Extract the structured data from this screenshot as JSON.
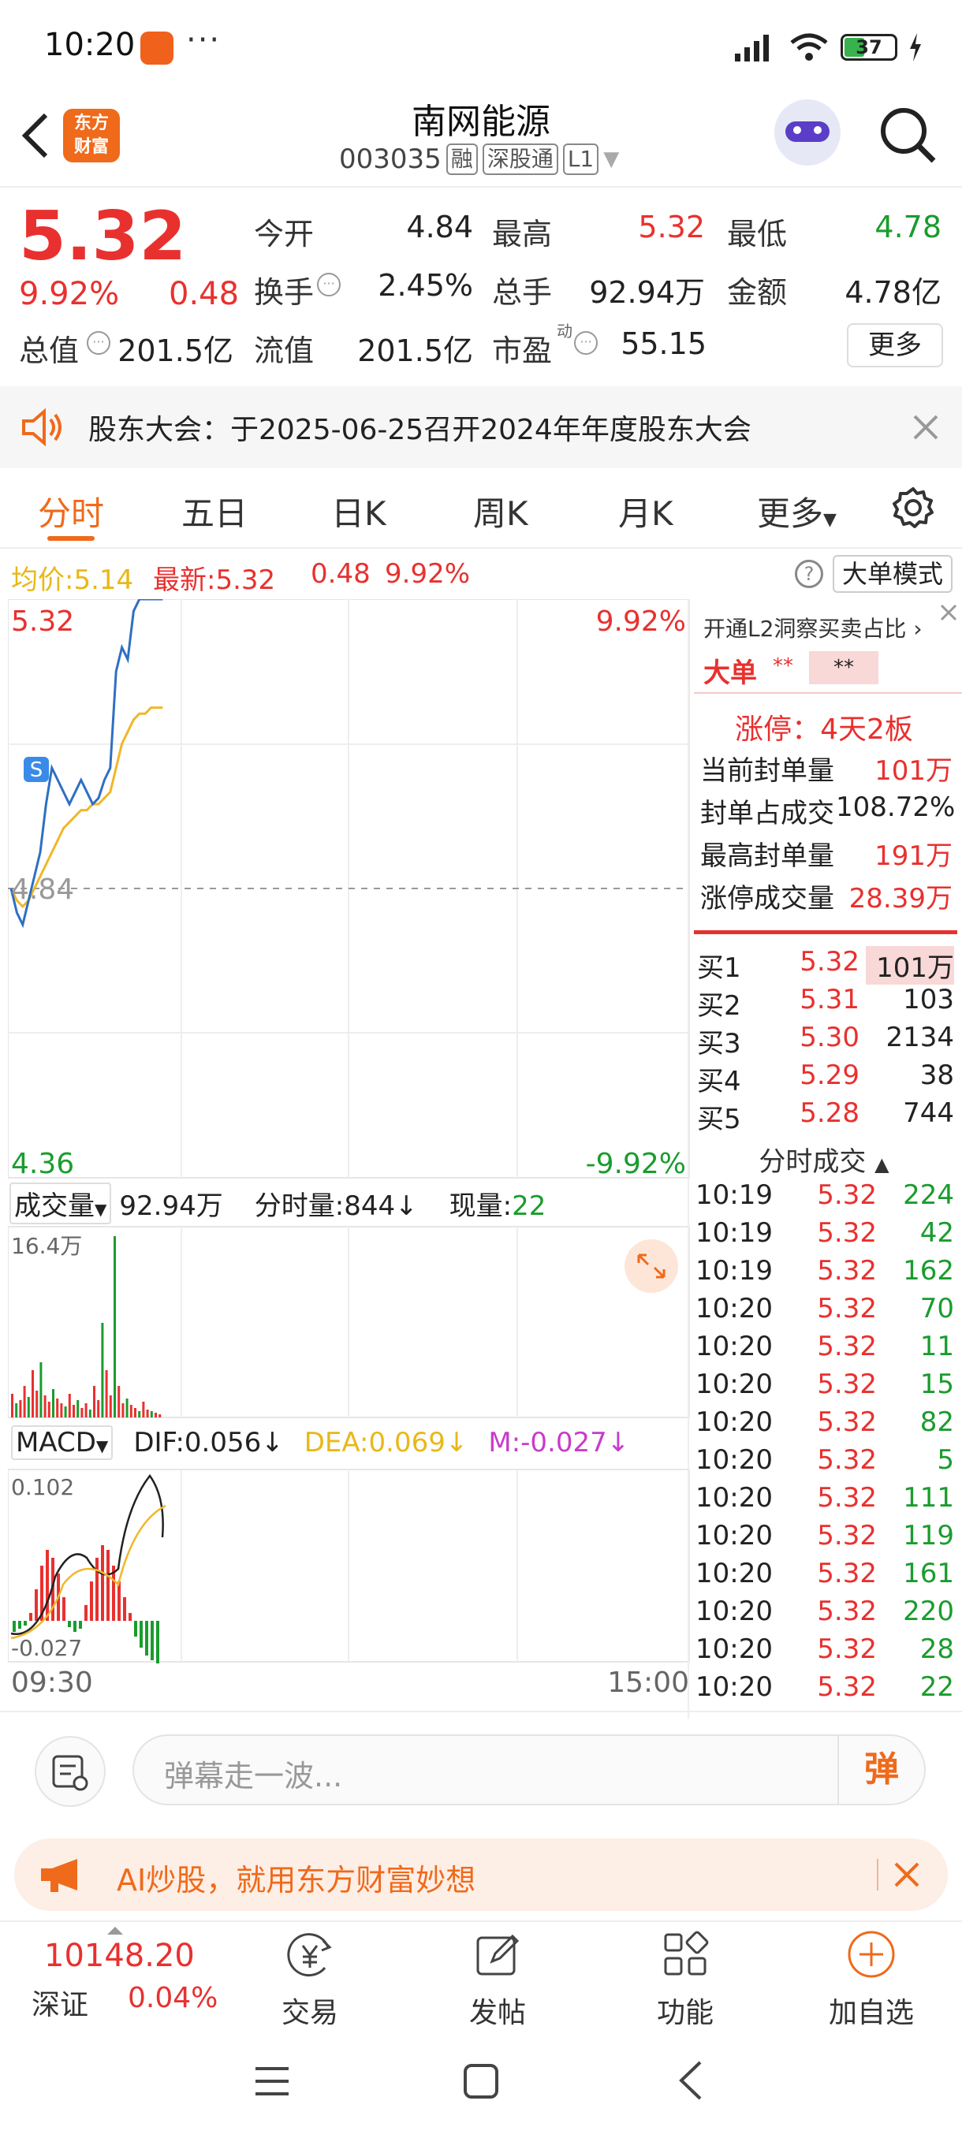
{
  "status_bar": {
    "time": "10:20",
    "battery": "37"
  },
  "header": {
    "title": "南网能源",
    "code": "003035",
    "tags": [
      "融",
      "深股通",
      "L1"
    ],
    "logo_lines": [
      "东方",
      "财富"
    ]
  },
  "quote": {
    "price": "5.32",
    "pct": "9.92%",
    "change": "0.48",
    "rows": [
      [
        {
          "l": "今开",
          "v": "4.84",
          "c": "black"
        },
        {
          "l": "最高",
          "v": "5.32",
          "c": "red"
        },
        {
          "l": "最低",
          "v": "4.78",
          "c": "green"
        }
      ],
      [
        {
          "l": "换手",
          "v": "2.45%",
          "c": "black"
        },
        {
          "l": "总手",
          "v": "92.94万",
          "c": "black"
        },
        {
          "l": "金额",
          "v": "4.78亿",
          "c": "black"
        }
      ],
      [
        {
          "l": "总值",
          "v": "201.5亿",
          "c": "black"
        },
        {
          "l": "流值",
          "v": "201.5亿",
          "c": "black"
        },
        {
          "l": "市盈",
          "v": "55.15",
          "c": "black",
          "sup": "动"
        }
      ]
    ],
    "more_label": "更多"
  },
  "notice": {
    "text": "股东大会：于2025-06-25召开2024年年度股东大会"
  },
  "tabs": [
    "分时",
    "五日",
    "日K",
    "周K",
    "月K",
    "更多"
  ],
  "info_row": {
    "avg_label": "均价:",
    "avg": "5.14",
    "latest_label": "最新:",
    "latest": "5.32",
    "chg": "0.48",
    "pct": "9.92%",
    "mode_btn": "大单模式"
  },
  "chart": {
    "top_left": "5.32",
    "top_right": "9.92%",
    "mid": "4.84",
    "bot_left": "4.36",
    "bot_right": "-9.92%",
    "time_start": "09:30",
    "time_end": "15:00",
    "vol_label": "成交量",
    "vol_total": "92.94万",
    "vol_tick_label": "分时量:844",
    "now_label": "现量:",
    "now_val": "22",
    "vol_max": "16.4万",
    "macd_label": "MACD",
    "dif": "DIF:0.056",
    "dea": "DEA:0.069",
    "m": "M:-0.027",
    "macd_top": "0.102",
    "macd_bot": "-0.027",
    "signal": "S"
  },
  "chart_data": {
    "type": "line",
    "title": "",
    "ylim": [
      4.36,
      5.32
    ],
    "series": [
      {
        "name": "price",
        "values": [
          4.84,
          4.8,
          4.78,
          4.82,
          4.86,
          4.9,
          4.98,
          5.04,
          5.02,
          5.0,
          4.98,
          5.0,
          5.02,
          5.0,
          4.98,
          4.99,
          5.02,
          5.04,
          5.2,
          5.24,
          5.22,
          5.3,
          5.32,
          5.32,
          5.32,
          5.32,
          5.32
        ]
      },
      {
        "name": "avg",
        "values": [
          4.84,
          4.82,
          4.81,
          4.82,
          4.84,
          4.86,
          4.88,
          4.9,
          4.92,
          4.94,
          4.95,
          4.96,
          4.97,
          4.97,
          4.98,
          4.98,
          4.99,
          5.0,
          5.04,
          5.08,
          5.1,
          5.12,
          5.13,
          5.13,
          5.14,
          5.14,
          5.14
        ]
      }
    ]
  },
  "right_panel": {
    "l2_link": "开通L2洞察买卖占比",
    "big_label": "大单",
    "big_mask1": "**",
    "big_mask2": "**",
    "limit_title": "涨停：4天2板",
    "stats": [
      {
        "l": "当前封单量",
        "v": "101万"
      },
      {
        "l": "封单占成交",
        "v": "108.72%"
      },
      {
        "l": "最高封单量",
        "v": "191万"
      },
      {
        "l": "涨停成交量",
        "v": "28.39万"
      }
    ],
    "orders": [
      {
        "l": "买1",
        "p": "5.32",
        "v": "101万"
      },
      {
        "l": "买2",
        "p": "5.31",
        "v": "103"
      },
      {
        "l": "买3",
        "p": "5.30",
        "v": "2134"
      },
      {
        "l": "买4",
        "p": "5.29",
        "v": "38"
      },
      {
        "l": "买5",
        "p": "5.28",
        "v": "744"
      }
    ],
    "trades_title": "分时成交",
    "trades": [
      {
        "t": "10:19",
        "p": "5.32",
        "v": "224"
      },
      {
        "t": "10:19",
        "p": "5.32",
        "v": "42"
      },
      {
        "t": "10:19",
        "p": "5.32",
        "v": "162"
      },
      {
        "t": "10:20",
        "p": "5.32",
        "v": "70"
      },
      {
        "t": "10:20",
        "p": "5.32",
        "v": "11"
      },
      {
        "t": "10:20",
        "p": "5.32",
        "v": "15"
      },
      {
        "t": "10:20",
        "p": "5.32",
        "v": "82"
      },
      {
        "t": "10:20",
        "p": "5.32",
        "v": "5"
      },
      {
        "t": "10:20",
        "p": "5.32",
        "v": "111"
      },
      {
        "t": "10:20",
        "p": "5.32",
        "v": "119"
      },
      {
        "t": "10:20",
        "p": "5.32",
        "v": "161"
      },
      {
        "t": "10:20",
        "p": "5.32",
        "v": "220"
      },
      {
        "t": "10:20",
        "p": "5.32",
        "v": "28"
      },
      {
        "t": "10:20",
        "p": "5.32",
        "v": "22"
      }
    ]
  },
  "comment": {
    "placeholder": "弹幕走一波...",
    "btn": "弹"
  },
  "ad": {
    "text": "AI炒股，就用东方财富妙想"
  },
  "bottom_nav": {
    "index_value": "10148.20",
    "index_name": "深证",
    "index_pct": "0.04%",
    "items": [
      {
        "label": "交易",
        "icon": "yen-icon"
      },
      {
        "label": "发帖",
        "icon": "edit-icon"
      },
      {
        "label": "功能",
        "icon": "grid-icon"
      },
      {
        "label": "加自选",
        "icon": "plus-circle-icon"
      }
    ]
  }
}
